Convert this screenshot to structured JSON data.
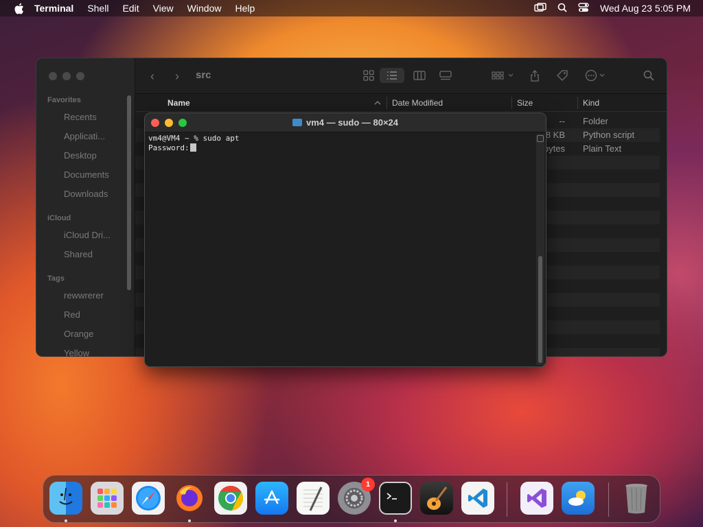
{
  "menubar": {
    "app_name": "Terminal",
    "items": [
      "Shell",
      "Edit",
      "View",
      "Window",
      "Help"
    ],
    "clock": "Wed Aug 23  5:05 PM"
  },
  "finder": {
    "path_title": "src",
    "sidebar": {
      "sections": {
        "favorites": "Favorites",
        "icloud": "iCloud",
        "tags": "Tags"
      },
      "favorites": [
        "Recents",
        "Applicati...",
        "Desktop",
        "Documents",
        "Downloads"
      ],
      "icloud": [
        "iCloud Dri...",
        "Shared"
      ],
      "tags": [
        "rewwrerer",
        "Red",
        "Orange",
        "Yellow"
      ]
    },
    "columns": {
      "name": "Name",
      "date_modified": "Date Modified",
      "size": "Size",
      "kind": "Kind"
    },
    "rows": [
      {
        "size": "--",
        "kind": "Folder"
      },
      {
        "size": "8 KB",
        "kind": "Python script"
      },
      {
        "size": "bytes",
        "kind": "Plain Text"
      }
    ]
  },
  "terminal": {
    "title": "vm4 — sudo — 80×24",
    "lines": [
      "vm4@VM4 ~ % sudo apt",
      "Password:"
    ]
  },
  "dock": {
    "apps": [
      {
        "name": "Finder",
        "icon": "finder-icon",
        "running": true
      },
      {
        "name": "Launchpad",
        "icon": "launchpad-icon",
        "running": false
      },
      {
        "name": "Safari",
        "icon": "safari-icon",
        "running": false
      },
      {
        "name": "Firefox",
        "icon": "firefox-icon",
        "running": true
      },
      {
        "name": "Chrome",
        "icon": "chrome-icon",
        "running": false
      },
      {
        "name": "App Store",
        "icon": "app-store-icon",
        "running": false
      },
      {
        "name": "TextEdit",
        "icon": "textedit-icon",
        "running": false
      },
      {
        "name": "System Settings",
        "icon": "settings-icon",
        "running": false,
        "badge": "1"
      },
      {
        "name": "Terminal",
        "icon": "terminal-icon",
        "running": true
      },
      {
        "name": "GarageBand",
        "icon": "garageband-icon",
        "running": false
      },
      {
        "name": "VS Code",
        "icon": "vscode-icon",
        "running": false
      },
      {
        "name": "Visual Studio",
        "icon": "visual-studio-icon",
        "running": false
      },
      {
        "name": "Weather",
        "icon": "weather-icon",
        "running": false
      },
      {
        "name": "Trash",
        "icon": "trash-icon",
        "running": false
      }
    ]
  },
  "colors": {
    "terminal_bg": "#1e1e1e",
    "close": "#ff5f57",
    "minimize": "#febc2e",
    "zoom": "#28c840",
    "badge": "#ff3b30"
  }
}
